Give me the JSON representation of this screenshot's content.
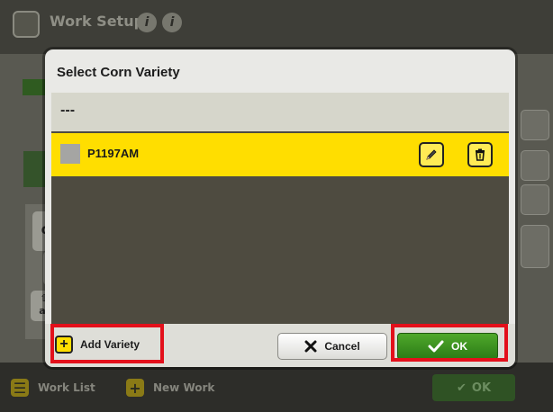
{
  "app": {
    "title": "Work Setup",
    "info_icons": [
      "info-icon",
      "info-icon"
    ]
  },
  "footer": {
    "work_list_label": "Work List",
    "new_work_label": "New Work",
    "ok_label": "OK"
  },
  "keyboard": {
    "key_q": "q",
    "key_shift_sub": "a/"
  },
  "dialog": {
    "title": "Select Corn Variety",
    "rows": [
      {
        "label": "---",
        "selected": false
      },
      {
        "label": "P1197AM",
        "selected": true,
        "swatch_color": "#a5a5a3"
      }
    ],
    "add_label": "Add Variety",
    "cancel_label": "Cancel",
    "ok_label": "OK"
  },
  "colors": {
    "accent_yellow": "#ffde00",
    "ok_green": "#3a9220",
    "highlight_red": "#e3101b"
  }
}
